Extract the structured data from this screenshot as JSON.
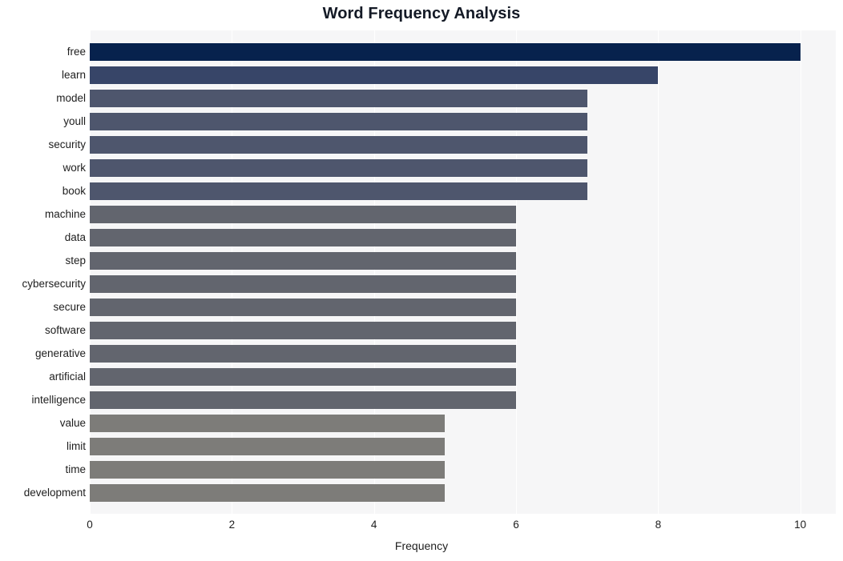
{
  "chart_data": {
    "type": "bar",
    "orientation": "horizontal",
    "title": "Word Frequency Analysis",
    "xlabel": "Frequency",
    "ylabel": "",
    "xlim": [
      0,
      10.5
    ],
    "xticks": [
      0,
      2,
      4,
      6,
      8,
      10
    ],
    "xtick_labels": [
      "0",
      "2",
      "4",
      "6",
      "8",
      "10"
    ],
    "grid": true,
    "grid_axis": "x",
    "grid_color": "#ffffff",
    "plot_background": "#f6f6f7",
    "figure_background": "#ffffff",
    "legend": null,
    "categories": [
      "free",
      "learn",
      "model",
      "youll",
      "security",
      "work",
      "book",
      "machine",
      "data",
      "step",
      "cybersecurity",
      "secure",
      "software",
      "generative",
      "artificial",
      "intelligence",
      "value",
      "limit",
      "time",
      "development"
    ],
    "values": [
      10,
      8,
      7,
      7,
      7,
      7,
      7,
      6,
      6,
      6,
      6,
      6,
      6,
      6,
      6,
      6,
      5,
      5,
      5,
      5
    ],
    "bar_colors": [
      "#07224d",
      "#374568",
      "#4e566d",
      "#4e566d",
      "#4e566d",
      "#4e566d",
      "#4e566d",
      "#62656e",
      "#62656e",
      "#62656e",
      "#62656e",
      "#62656e",
      "#62656e",
      "#62656e",
      "#62656e",
      "#62656e",
      "#7d7c79",
      "#7d7c79",
      "#7d7c79",
      "#7d7c79"
    ]
  }
}
